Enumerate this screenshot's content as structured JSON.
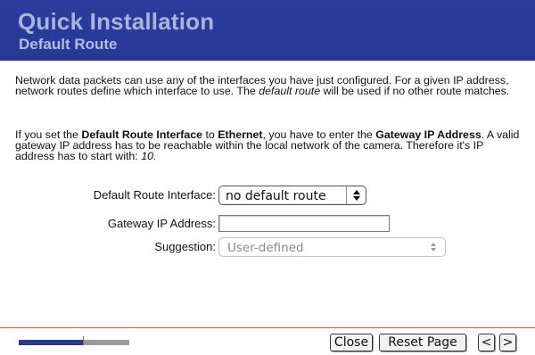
{
  "header": {
    "title": "Quick Installation",
    "subtitle": "Default Route"
  },
  "intro": {
    "p1_part1": "Network data packets can use any of the interfaces you have just configured. For a given IP address, network routes define which interface to use. The ",
    "p1_italic": "default route",
    "p1_part2": " will be used if no other route matches.",
    "p2_part1": "If you set the ",
    "p2_bold1": "Default Route Interface",
    "p2_part2": " to ",
    "p2_bold2": "Ethernet",
    "p2_part3": ", you have to enter the ",
    "p2_bold3": "Gateway IP Address",
    "p2_part4": ". A valid gateway IP address has to be reachable within the local network of the camera. Therefore it's IP address has to start with: ",
    "p2_italic": "10."
  },
  "form": {
    "route_interface_label": "Default Route Interface:",
    "route_interface_value": "no default route",
    "gateway_label": "Gateway IP Address:",
    "gateway_value": "",
    "suggestion_label": "Suggestion:",
    "suggestion_value": "User-defined"
  },
  "footer": {
    "progress_fraction": 0.58,
    "close_label": "Close",
    "reset_label": "Reset Page",
    "prev_label": "<",
    "next_label": ">"
  },
  "colors": {
    "header_bg": "#2a3894",
    "header_text": "#a9b4dd",
    "rule": "#e04545",
    "progress_fill": "#2a3894",
    "progress_track": "#9a9a9a"
  }
}
